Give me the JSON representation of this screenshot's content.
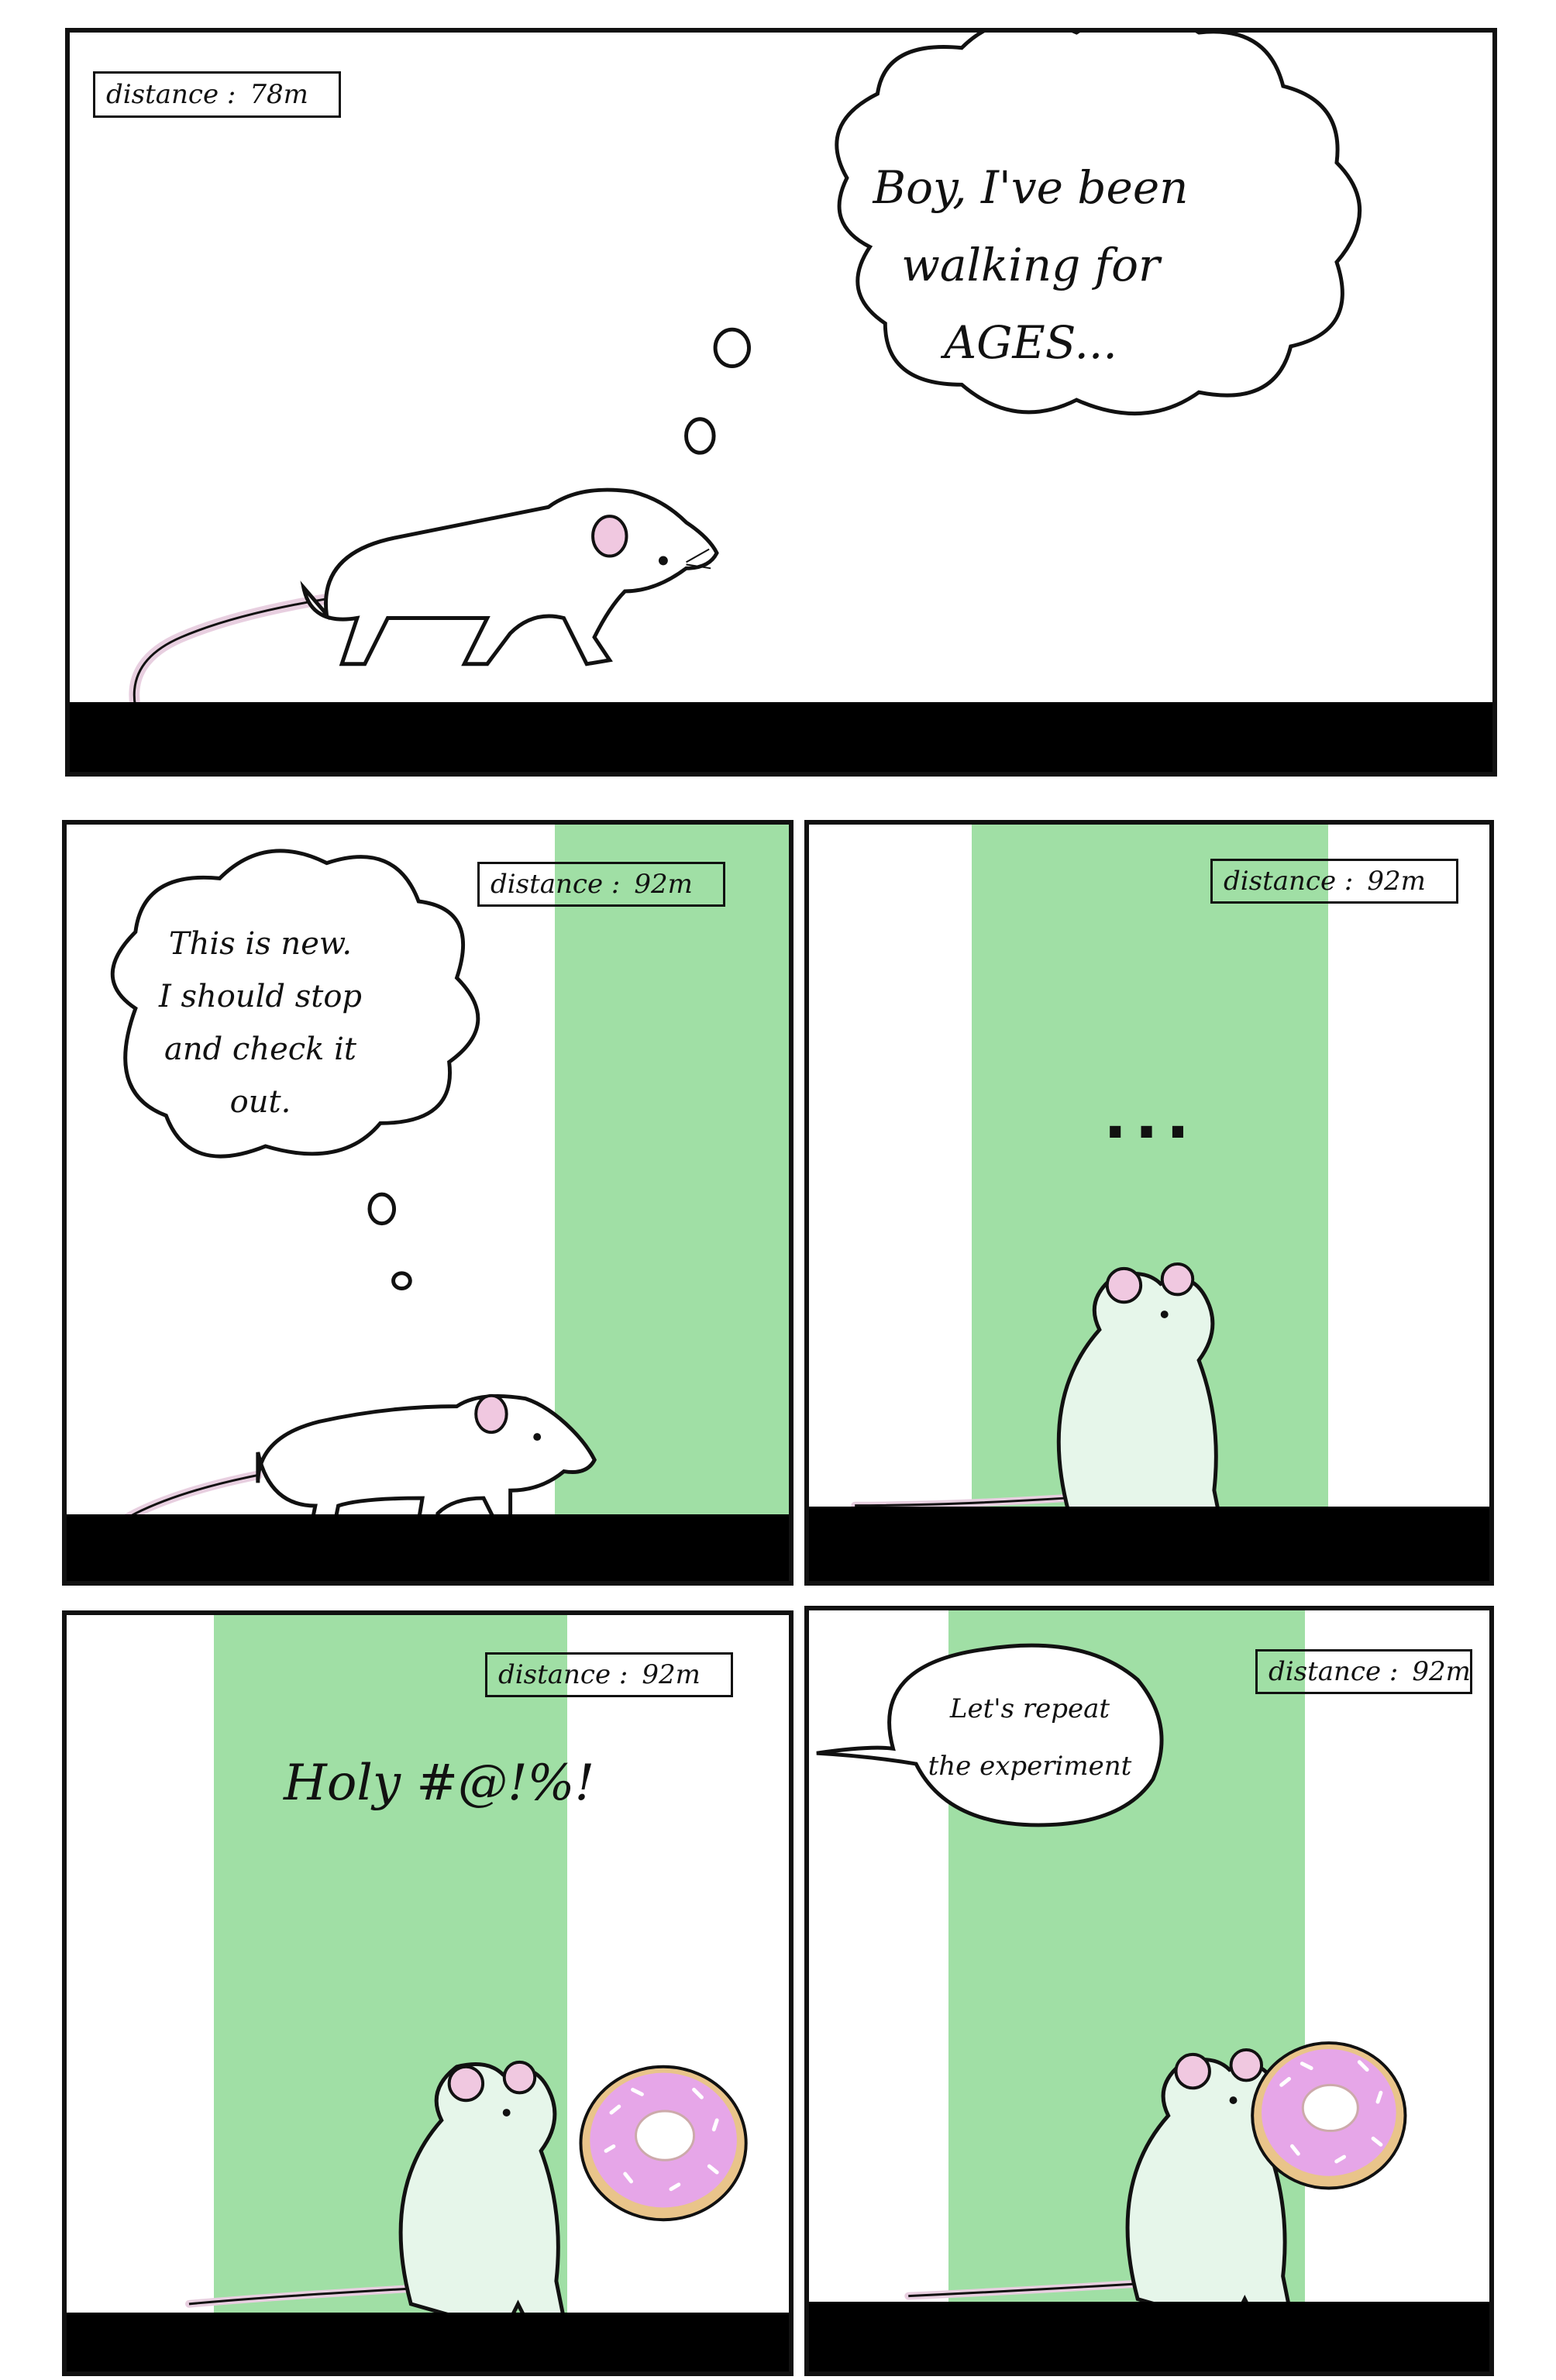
{
  "distance_label": "distance :",
  "panels": [
    {
      "distance": "78m",
      "thought": [
        "Boy, I've been",
        "walking for",
        "AGES..."
      ]
    },
    {
      "distance": "92m",
      "thought": [
        "This is new.",
        "I should stop",
        "and check it",
        "out."
      ]
    },
    {
      "distance": "92m",
      "text": "..."
    },
    {
      "distance": "92m",
      "text": "Holy #@!%!"
    },
    {
      "distance": "92m",
      "speech": [
        "Let's repeat",
        "the experiment"
      ]
    }
  ],
  "colors": {
    "zone": "#a0dfa5",
    "floor": "#000000",
    "donut_icing": "#e6a6e8",
    "donut_dough": "#e9c48a",
    "tail": "#e8cfe0"
  }
}
